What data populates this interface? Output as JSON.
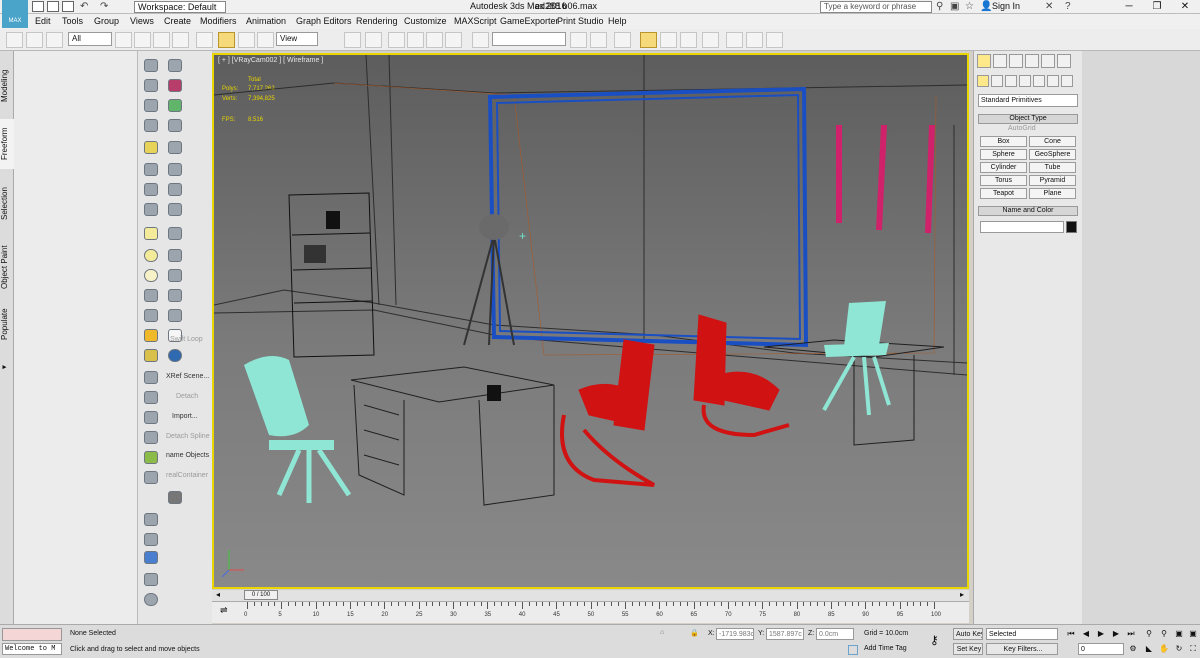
{
  "title_bar": {
    "workspace": "Workspace: Default",
    "app_title": "Autodesk 3ds Max 2016",
    "file_name": "ed288 b06.max",
    "search_placeholder": "Type a keyword or phrase",
    "sign_in": "Sign In"
  },
  "menu": [
    "Edit",
    "Tools",
    "Group",
    "Views",
    "Create",
    "Modifiers",
    "Animation",
    "Graph Editors",
    "Rendering",
    "Customize",
    "MAXScript",
    "GameExporter",
    "Print Studio",
    "Help"
  ],
  "logo": "MAX",
  "toolbar": {
    "selection_filter": "All",
    "ref_coord": "View"
  },
  "ribbon_tabs": [
    "Modeling",
    "Freeform",
    "Selection",
    "Object Paint",
    "Populate"
  ],
  "tool_labels": {
    "swift_loop": "Swift Loop",
    "xref": "XRef Scene...",
    "detach": "Detach",
    "import": "Import...",
    "detach_spline": "Detach Spline",
    "name_objects": "name Objects",
    "realcontainer": "realContainer"
  },
  "viewport": {
    "label": "[ + ] [VRayCam002 ] [ Wireframe ]",
    "stats_total": "Total",
    "polys_label": "Polys:",
    "polys_value": "7,717,262",
    "verts_label": "Verts:",
    "verts_value": "7,394,825",
    "fps_label": "FPS:",
    "fps_value": "8.516"
  },
  "command_panel": {
    "dropdown": "Standard Primitives",
    "object_type_header": "Object Type",
    "autogrid": "AutoGrid",
    "buttons": [
      "Box",
      "Cone",
      "Sphere",
      "GeoSphere",
      "Cylinder",
      "Tube",
      "Torus",
      "Pyramid",
      "Teapot",
      "Plane"
    ],
    "name_color_header": "Name and Color",
    "object_color": "#111111"
  },
  "timeline": {
    "frame_display": "0 / 100",
    "ticks": [
      "0",
      "5",
      "10",
      "15",
      "20",
      "25",
      "30",
      "35",
      "40",
      "45",
      "50",
      "55",
      "60",
      "65",
      "70",
      "75",
      "80",
      "85",
      "90",
      "95",
      "100"
    ]
  },
  "status": {
    "maxscript_listener": "Welcome to M",
    "selection": "None Selected",
    "prompt": "Click and drag to select and move objects",
    "x_label": "X:",
    "x_value": "-1719.983c",
    "y_label": "Y:",
    "y_value": "1587.897c",
    "z_label": "Z:",
    "z_value": "0.0cm",
    "grid": "Grid = 10.0cm",
    "add_time_tag": "Add Time Tag",
    "auto_key": "Auto Key",
    "set_key": "Set Key",
    "key_mode": "Selected",
    "key_filters": "Key Filters...",
    "current_frame": "0"
  },
  "colors": {
    "viewport_border": "#e9d600",
    "chair_red": "#d01212",
    "chair_cyan": "#8fe6d5",
    "window_frame": "#1a4fc4",
    "stripes": "#d0226a"
  }
}
